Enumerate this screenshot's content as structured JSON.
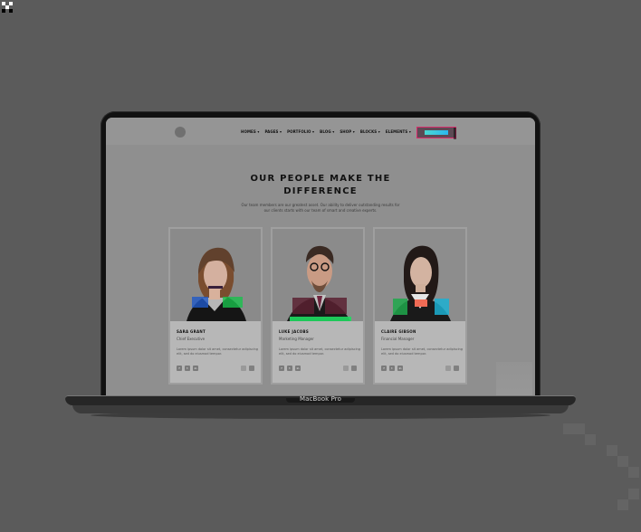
{
  "page": {
    "brand_label": "MacBook Pro"
  },
  "site": {
    "nav_items": [
      "HOMES ▾",
      "PAGES ▾",
      "PORTFOLIO ▾",
      "BLOG ▾",
      "SHOP ▾",
      "BLOCKS ▾",
      "ELEMENTS ▾"
    ],
    "hero": {
      "title_line_1": "OUR PEOPLE MAKE THE",
      "title_line_2": "DIFFERENCE",
      "subtitle_line_1": "Our team members are our greatest asset. Our ability to deliver outstanding results for",
      "subtitle_line_2": "our clients starts with our team of smart and creative experts."
    },
    "team": [
      {
        "name": "SARA GRANT",
        "role": "Chief Executive",
        "bio_line_1": "Lorem ipsum dolor sit amet, consectetur adipiscing",
        "bio_line_2": "elit, sed do eiusmod tempor."
      },
      {
        "name": "LUKE JACOBS",
        "role": "Marketing Manager",
        "bio_line_1": "Lorem ipsum dolor sit amet, consectetur adipiscing",
        "bio_line_2": "elit, sed do eiusmod tempor."
      },
      {
        "name": "CLAIRE GIBSON",
        "role": "Financial Manager",
        "bio_line_1": "Lorem ipsum dolor sit amet, consectetur adipiscing",
        "bio_line_2": "elit, sed do eiusmod tempor."
      }
    ]
  }
}
